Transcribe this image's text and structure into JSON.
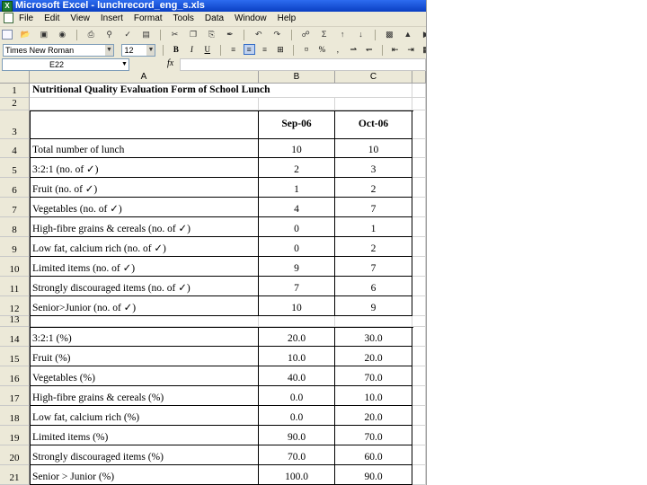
{
  "window": {
    "title": "Microsoft Excel - lunchrecord_eng_s.xls"
  },
  "menu": [
    "File",
    "Edit",
    "View",
    "Insert",
    "Format",
    "Tools",
    "Data",
    "Window",
    "Help"
  ],
  "format_toolbar": {
    "font": "Times New Roman",
    "size": "12",
    "bold": "B",
    "italic": "I",
    "underline": "U",
    "percent": "%"
  },
  "formula_bar": {
    "name_box": "E22",
    "fx": "fx",
    "value": ""
  },
  "columns": [
    "A",
    "B",
    "C"
  ],
  "sheet": {
    "title": "Nutritional Quality Evaluation Form of School Lunch",
    "months": [
      "Sep-06",
      "Oct-06"
    ],
    "rows": [
      {
        "n": "1"
      },
      {
        "n": "2"
      },
      {
        "n": "3"
      },
      {
        "n": "4",
        "label": "Total number of lunch",
        "b": "10",
        "c": "10"
      },
      {
        "n": "5",
        "label": "3:2:1 (no. of ✓)",
        "b": "2",
        "c": "3"
      },
      {
        "n": "6",
        "label": "Fruit (no. of ✓)",
        "b": "1",
        "c": "2"
      },
      {
        "n": "7",
        "label": "Vegetables (no. of ✓)",
        "b": "4",
        "c": "7"
      },
      {
        "n": "8",
        "label": "High-fibre grains & cereals (no. of ✓)",
        "b": "0",
        "c": "1"
      },
      {
        "n": "9",
        "label": "Low fat, calcium rich (no. of ✓)",
        "b": "0",
        "c": "2"
      },
      {
        "n": "10",
        "label": "Limited items (no. of ✓)",
        "b": "9",
        "c": "7"
      },
      {
        "n": "11",
        "label": "Strongly discouraged items (no. of ✓)",
        "b": "7",
        "c": "6"
      },
      {
        "n": "12",
        "label": "Senior>Junior (no. of ✓)",
        "b": "10",
        "c": "9"
      },
      {
        "n": "13"
      },
      {
        "n": "14",
        "label": "3:2:1 (%)",
        "b": "20.0",
        "c": "30.0"
      },
      {
        "n": "15",
        "label": "Fruit (%)",
        "b": "10.0",
        "c": "20.0"
      },
      {
        "n": "16",
        "label": "Vegetables  (%)",
        "b": "40.0",
        "c": "70.0"
      },
      {
        "n": "17",
        "label": "High-fibre grains & cereals (%)",
        "b": "0.0",
        "c": "10.0"
      },
      {
        "n": "18",
        "label": "Low fat, calcium rich (%)",
        "b": "0.0",
        "c": "20.0"
      },
      {
        "n": "19",
        "label": "Limited items (%)",
        "b": "90.0",
        "c": "70.0"
      },
      {
        "n": "20",
        "label": "Strongly discouraged items (%)",
        "b": "70.0",
        "c": "60.0"
      },
      {
        "n": "21",
        "label": "Senior > Junior (%)",
        "b": "100.0",
        "c": "90.0"
      }
    ]
  }
}
